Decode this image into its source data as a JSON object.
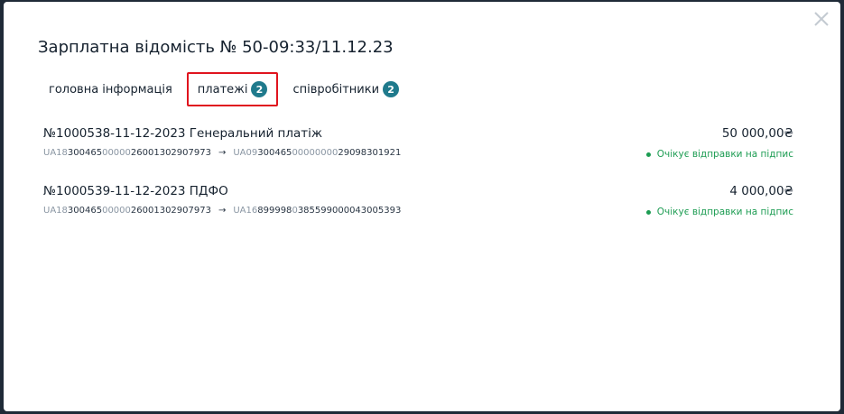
{
  "modal": {
    "title": "Зарплатна відомість № 50-09:33/11.12.23",
    "close_icon": "close-icon"
  },
  "tabs": [
    {
      "label": "головна інформація",
      "badge": null
    },
    {
      "label": "платежі",
      "badge": "2",
      "active": true
    },
    {
      "label": "співробітники",
      "badge": "2"
    }
  ],
  "payments": [
    {
      "title": "№1000538-11-12-2023 Генеральний платіж",
      "amount": "50 000,00₴",
      "from": {
        "prefix": "UA18",
        "mid": "300465",
        "zeros": "00000",
        "tail": "26001302907973"
      },
      "to": {
        "prefix": "UA09",
        "mid": "300465",
        "zeros": "00000000",
        "tail": "29098301921"
      },
      "status": "Очікує відправки на підпис"
    },
    {
      "title": "№1000539-11-12-2023 ПДФО",
      "amount": "4 000,00₴",
      "from": {
        "prefix": "UA18",
        "mid": "300465",
        "zeros": "00000",
        "tail": "26001302907973"
      },
      "to": {
        "prefix": "UA16",
        "mid": "899998",
        "zeros": "0",
        "tail": "385599000043005393"
      },
      "status": "Очікує відправки на підпис"
    }
  ],
  "colors": {
    "accent": "#1f7a8c",
    "status": "#1c9c52",
    "highlight": "#e0141e"
  },
  "arrow_glyph": "→"
}
